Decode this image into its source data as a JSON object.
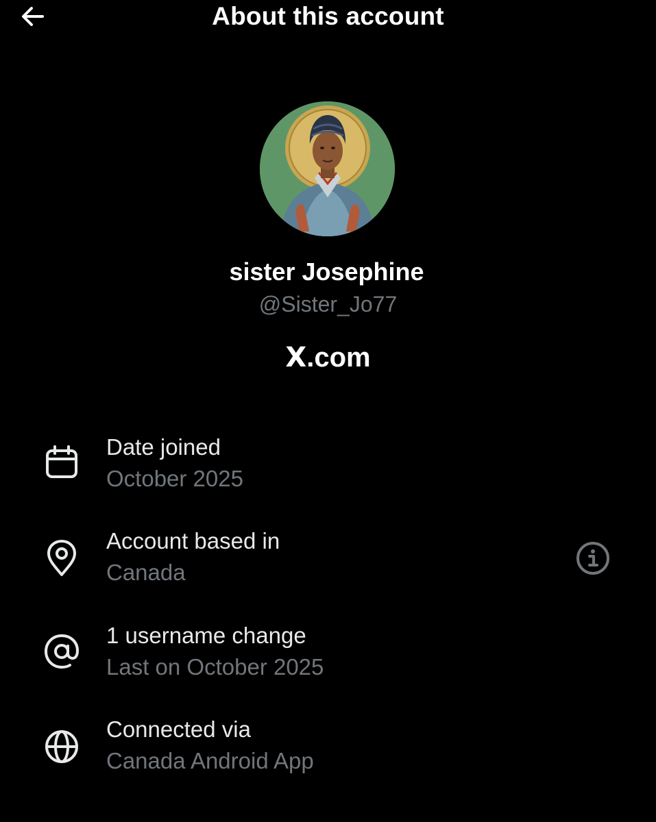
{
  "header": {
    "back_icon": "arrow-left-icon",
    "title": "About this account"
  },
  "profile": {
    "avatar_desc_icon": "icon-portrait-avatar",
    "display_name": "sister Josephine",
    "handle": "@Sister_Jo77",
    "site_logo": "X",
    "site_domain": ".com"
  },
  "details": [
    {
      "icon": "calendar-icon",
      "label": "Date joined",
      "value": "October 2025"
    },
    {
      "icon": "location-pin-icon",
      "label": "Account based in",
      "value": "Canada",
      "info_icon": "info-icon"
    },
    {
      "icon": "at-sign-icon",
      "label": "1 username change",
      "value": "Last on October 2025"
    },
    {
      "icon": "globe-icon",
      "label": "Connected via",
      "value": "Canada Android App"
    }
  ],
  "colors": {
    "background": "#000000",
    "primary_text": "#e7e9ea",
    "secondary_text": "#71767b",
    "title_text": "#ffffff"
  }
}
